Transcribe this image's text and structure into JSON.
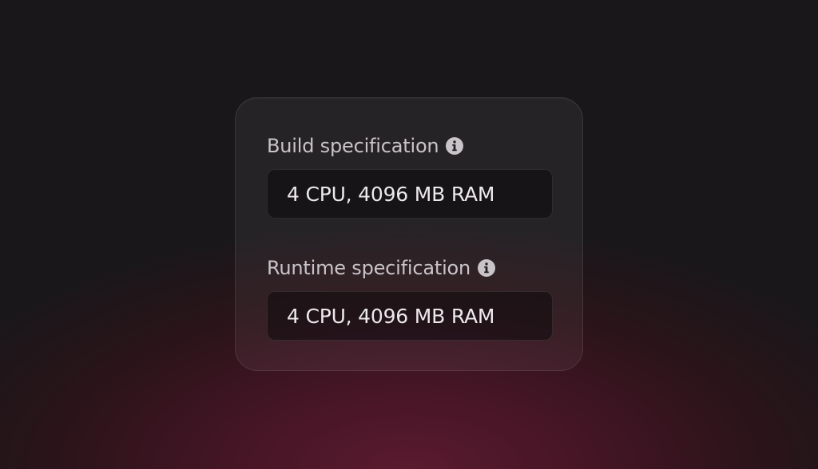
{
  "build_spec": {
    "label": "Build specification",
    "info_icon": "info-icon",
    "value": "4 CPU, 4096 MB RAM"
  },
  "runtime_spec": {
    "label": "Runtime specification",
    "info_icon": "info-icon",
    "value": "4 CPU, 4096 MB RAM"
  },
  "colors": {
    "background_top": "#19171a",
    "background_glow": "#5a1a30",
    "label_text": "#c8c4c8",
    "value_text": "#ece9ec",
    "icon_fill": "#c8c4c8"
  }
}
